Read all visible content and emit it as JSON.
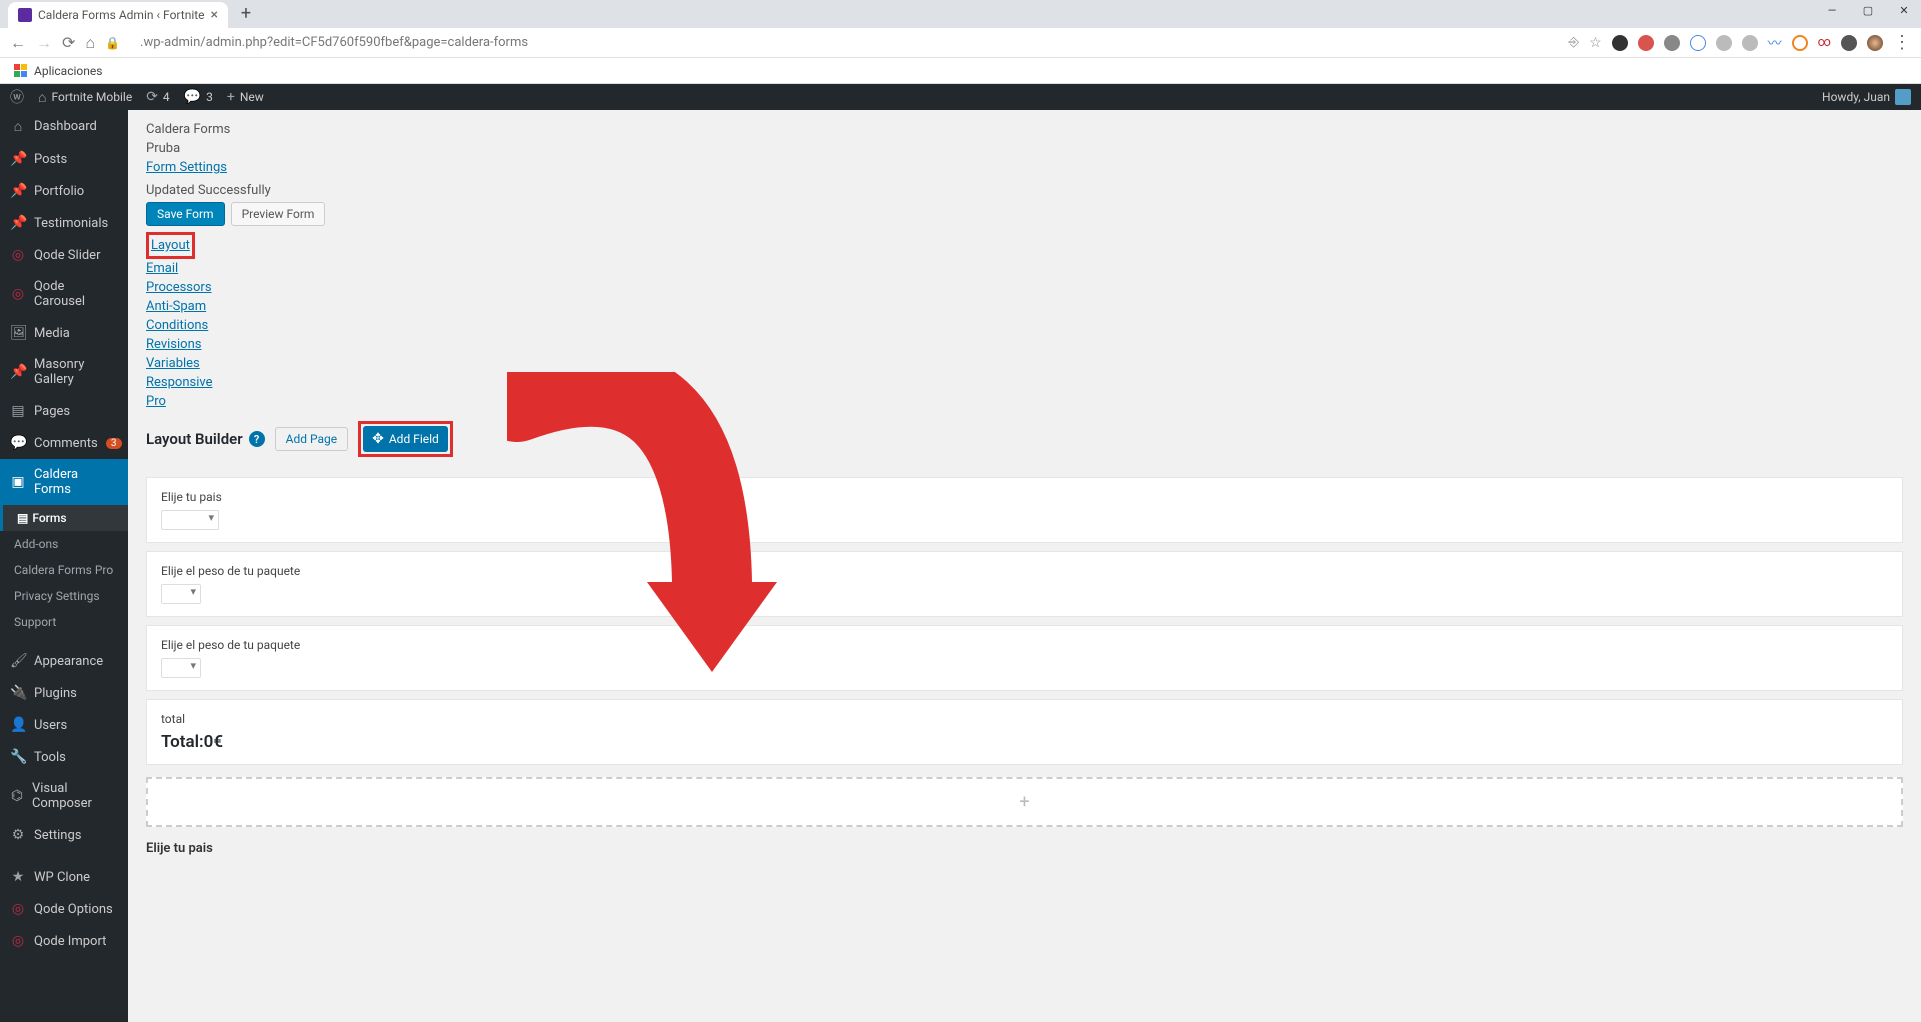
{
  "browser": {
    "tab_title": "Caldera Forms Admin ‹ Fortnite",
    "url": ".wp-admin/admin.php?edit=CF5d760f590fbef&page=caldera-forms",
    "bookmarks_label": "Aplicaciones"
  },
  "adminbar": {
    "site": "Fortnite Mobile",
    "updates": "4",
    "comments": "3",
    "new_label": "New",
    "howdy": "Howdy, Juan"
  },
  "sidebar": {
    "items": [
      {
        "label": "Dashboard",
        "icon": "⌂"
      },
      {
        "label": "Posts",
        "icon": "📌"
      },
      {
        "label": "Portfolio",
        "icon": "📌"
      },
      {
        "label": "Testimonials",
        "icon": "📌"
      },
      {
        "label": "Qode Slider",
        "icon": "◎",
        "red": true
      },
      {
        "label": "Qode Carousel",
        "icon": "◎",
        "red": true
      },
      {
        "label": "Media",
        "icon": "🖼"
      },
      {
        "label": "Masonry Gallery",
        "icon": "📌"
      },
      {
        "label": "Pages",
        "icon": "▤"
      },
      {
        "label": "Comments",
        "icon": "💬",
        "badge": "3"
      },
      {
        "label": "Caldera Forms",
        "icon": "▣",
        "active": true
      },
      {
        "label": "Appearance",
        "icon": "🖌"
      },
      {
        "label": "Plugins",
        "icon": "🔌"
      },
      {
        "label": "Users",
        "icon": "👤"
      },
      {
        "label": "Tools",
        "icon": "🔧"
      },
      {
        "label": "Visual Composer",
        "icon": "⌬"
      },
      {
        "label": "Settings",
        "icon": "⚙"
      },
      {
        "label": "WP Clone",
        "icon": "★"
      },
      {
        "label": "Qode Options",
        "icon": "◎",
        "red": true
      },
      {
        "label": "Qode Import",
        "icon": "◎",
        "red": true
      }
    ],
    "subitems": [
      {
        "label": "Forms",
        "current": true
      },
      {
        "label": "Add-ons"
      },
      {
        "label": "Caldera Forms Pro"
      },
      {
        "label": "Privacy Settings"
      },
      {
        "label": "Support"
      }
    ]
  },
  "page": {
    "plugin_title": "Caldera Forms",
    "form_name": "Pruba",
    "form_settings_link": "Form Settings",
    "update_msg": "Updated Successfully",
    "save_label": "Save Form",
    "preview_label": "Preview Form",
    "tabs": [
      "Layout",
      "Email",
      "Processors",
      "Anti-Spam",
      "Conditions",
      "Revisions",
      "Variables",
      "Responsive",
      "Pro"
    ],
    "builder_title": "Layout Builder",
    "add_page_label": "Add Page",
    "add_field_label": "Add Field",
    "fields": [
      {
        "label": "Elije tu pais",
        "select": "▾"
      },
      {
        "label": "Elije el peso de tu paquete",
        "select": "▾",
        "small": true
      },
      {
        "label": "Elije el peso de tu paquete",
        "select": "▾",
        "small": true
      }
    ],
    "total_label": "total",
    "total_display": "Total:0€",
    "bottom_label": "Elije tu pais"
  }
}
